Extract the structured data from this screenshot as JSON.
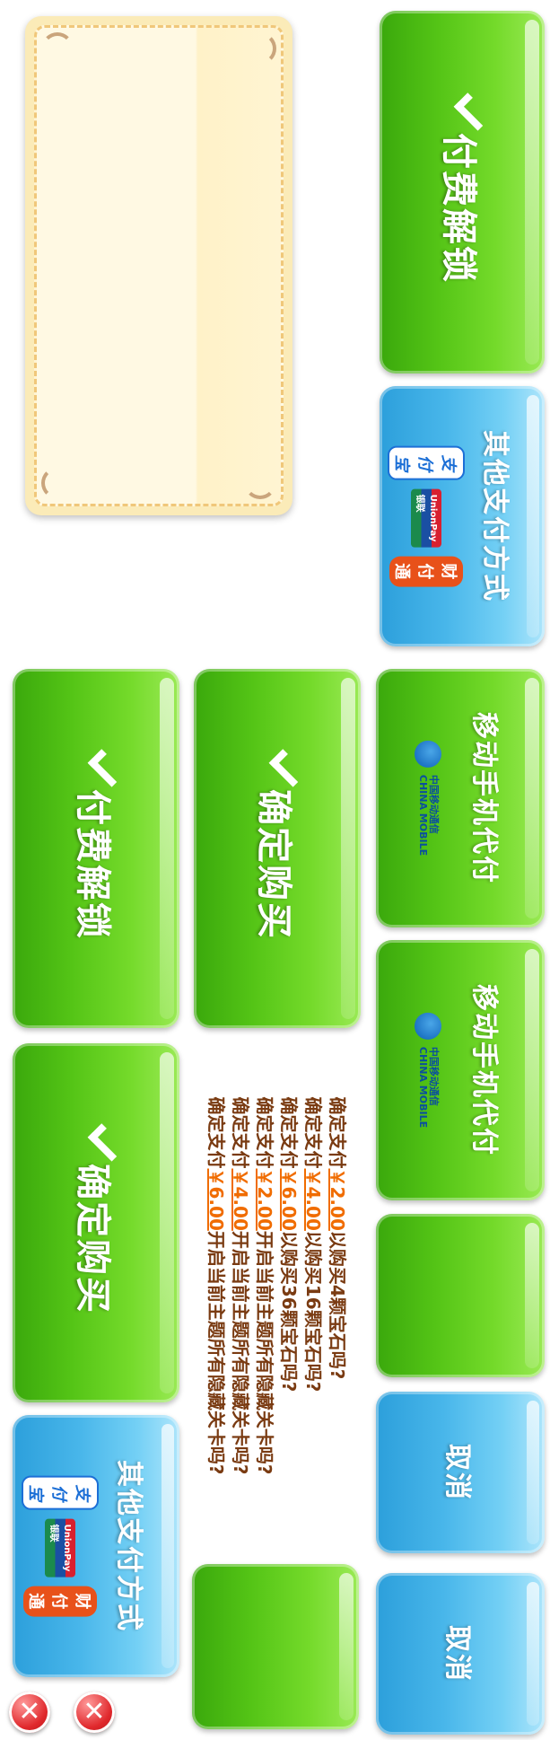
{
  "pay_unlock_label": "付费解锁",
  "confirm_buy_label": "确定购买",
  "other_pay": {
    "label": "其他支付方式",
    "logos": {
      "alipay": "支付宝",
      "unionpay": "UnionPay 银联",
      "tenpay": "财付通"
    }
  },
  "mobile_pay": {
    "label": "移动手机代付",
    "logo_cn": "中国移动通信",
    "logo_en": "CHINA MOBILE"
  },
  "cancel_label": "取消",
  "confirm_lines": [
    {
      "pre": "确定支付",
      "price": "￥2.00",
      "post": "以购买4颗宝石吗?"
    },
    {
      "pre": "确定支付",
      "price": "￥4.00",
      "post": "以购买16颗宝石吗?"
    },
    {
      "pre": "确定支付",
      "price": "￥6.00",
      "post": "以购买36颗宝石吗?"
    },
    {
      "pre": "确定支付",
      "price": "￥2.00",
      "post": "开启当前主题所有隐藏关卡吗?"
    },
    {
      "pre": "确定支付",
      "price": "￥4.00",
      "post": "开启当前主题所有隐藏关卡吗?"
    },
    {
      "pre": "确定支付",
      "price": "￥6.00",
      "post": "开启当前主题所有隐藏关卡吗?"
    }
  ],
  "close_glyph": "✕",
  "colors": {
    "green": "#54c416",
    "blue": "#48b6ea",
    "price": "#f06c00",
    "text_brown": "#7a3b12",
    "panel": "#fbebb8",
    "close_red": "#e0282c"
  },
  "icons": [
    "check-icon",
    "alipay-logo",
    "unionpay-logo",
    "tenpay-logo",
    "china-mobile-logo",
    "close-icon"
  ]
}
